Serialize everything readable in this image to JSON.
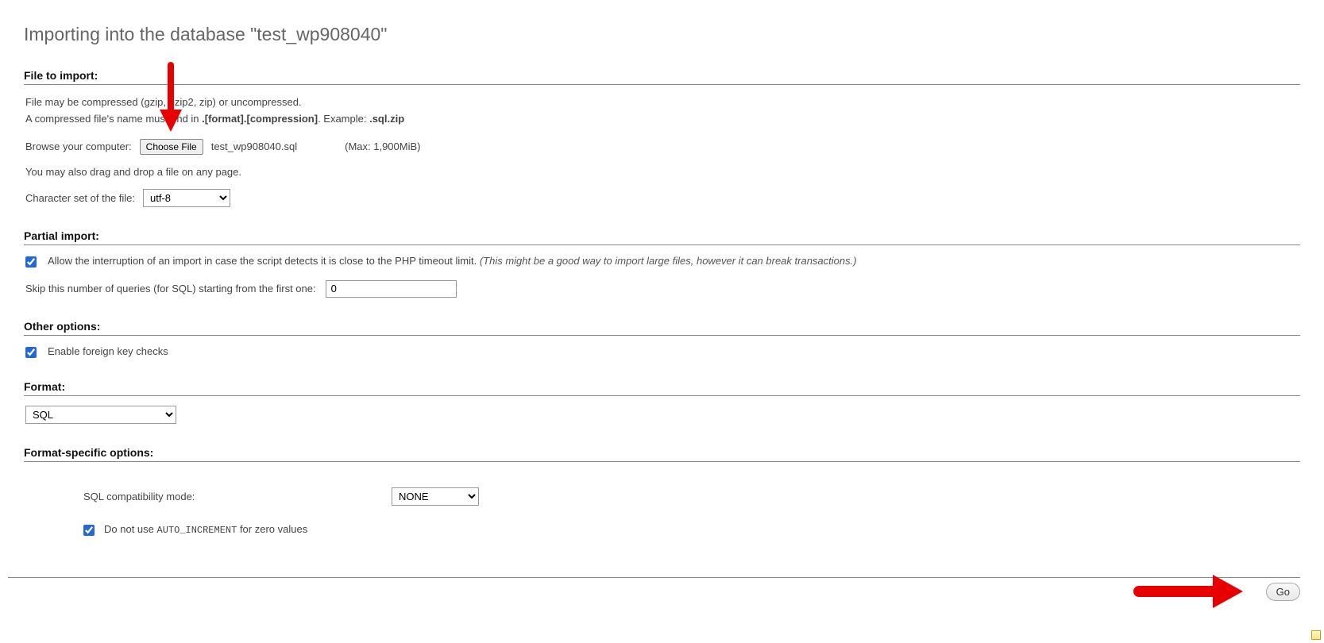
{
  "page_title": "Importing into the database \"test_wp908040\"",
  "file_to_import": {
    "heading": "File to import:",
    "help1": "File may be compressed (gzip, bzip2, zip) or uncompressed.",
    "help2_prefix": "A compressed file's name must end in ",
    "help2_bold1": ".[format].[compression]",
    "help2_mid": ". Example: ",
    "help2_bold2": ".sql.zip",
    "browse_label": "Browse your computer:",
    "choose_file_btn": "Choose File",
    "selected_filename": "test_wp908040.sql",
    "max_size": "(Max: 1,900MiB)",
    "drop_hint": "You may also drag and drop a file on any page.",
    "charset_label": "Character set of the file:",
    "charset_value": "utf-8"
  },
  "partial_import": {
    "heading": "Partial import:",
    "allow_interruption_text": "Allow the interruption of an import in case the script detects it is close to the PHP timeout limit. ",
    "allow_interruption_hint": "(This might be a good way to import large files, however it can break transactions.)",
    "skip_label": "Skip this number of queries (for SQL) starting from the first one:",
    "skip_value": "0"
  },
  "other_options": {
    "heading": "Other options:",
    "foreign_key_label": "Enable foreign key checks"
  },
  "format": {
    "heading": "Format:",
    "value": "SQL"
  },
  "format_specific": {
    "heading": "Format-specific options:",
    "compat_label": "SQL compatibility mode:",
    "compat_value": "NONE",
    "zero_values_prefix": "Do not use ",
    "zero_values_code": "AUTO_INCREMENT",
    "zero_values_suffix": " for zero values"
  },
  "go_button": "Go"
}
